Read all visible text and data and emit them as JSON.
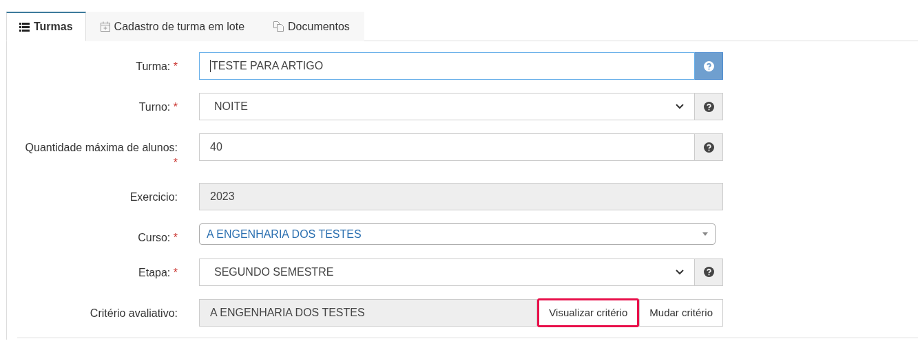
{
  "tabs": [
    {
      "label": "Turmas",
      "selected": true
    },
    {
      "label": "Cadastro de turma em lote",
      "selected": false
    },
    {
      "label": "Documentos",
      "selected": false
    }
  ],
  "fields": [
    {
      "kind": "text",
      "label": "Turma:",
      "required_mark": "*",
      "value": "TESTE PARA ARTIGO",
      "focused": true,
      "help": true
    },
    {
      "kind": "select",
      "label": "Turno:",
      "required_mark": "*",
      "value": "NOITE",
      "help": true
    },
    {
      "kind": "text",
      "label": "Quantidade máxima de alunos:",
      "required_mark": "*",
      "value": "40",
      "focused": false,
      "help": true
    },
    {
      "kind": "readonly",
      "label": "Exercicio:",
      "value": "2023"
    },
    {
      "kind": "combo",
      "label": "Curso:",
      "required_mark": "*",
      "value": "A ENGENHARIA DOS TESTES"
    },
    {
      "kind": "select",
      "label": "Etapa:",
      "required_mark": "*",
      "value": "SEGUNDO SEMESTRE",
      "help": true
    },
    {
      "kind": "criteria",
      "label": "Critério avaliativo:",
      "value": "A ENGENHARIA DOS TESTES",
      "buttons": [
        {
          "label": "Visualizar critério",
          "highlighted": true
        },
        {
          "label": "Mudar critério",
          "highlighted": false
        }
      ]
    }
  ]
}
